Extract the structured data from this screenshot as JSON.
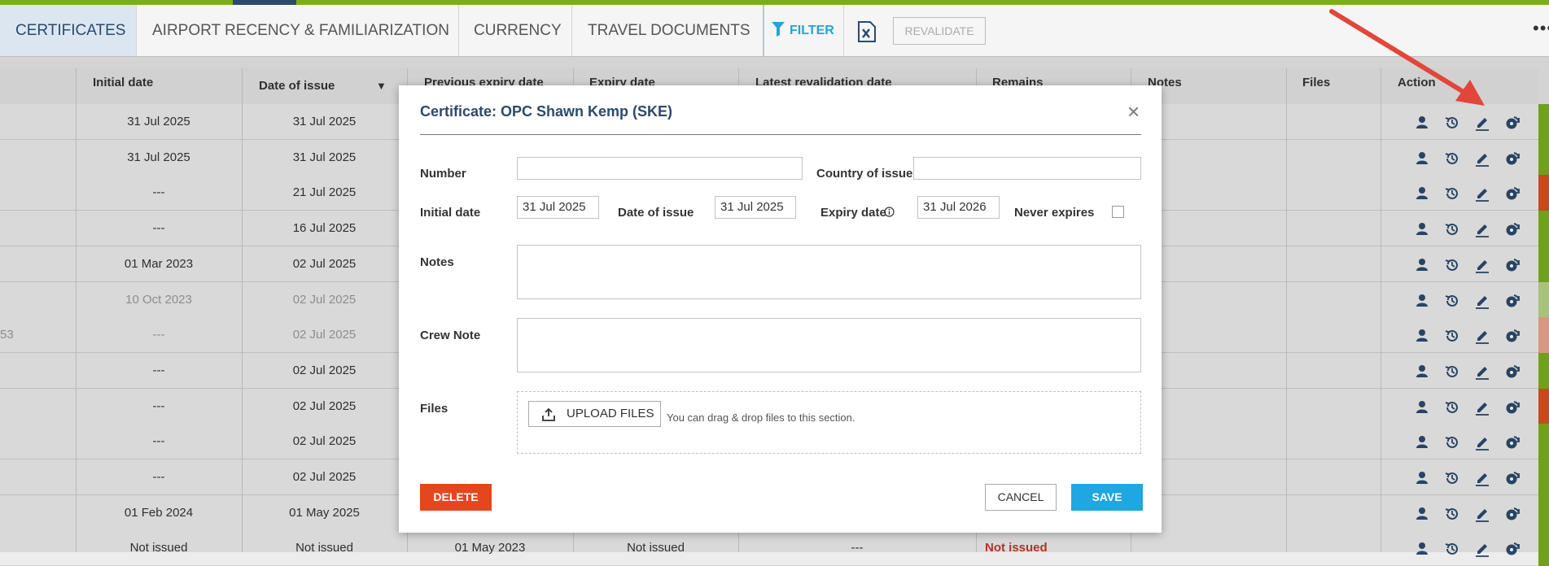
{
  "tabs": [
    {
      "label": "CERTIFICATES"
    },
    {
      "label": "AIRPORT RECENCY & FAMILIARIZATION"
    },
    {
      "label": "CURRENCY"
    },
    {
      "label": "TRAVEL DOCUMENTS"
    }
  ],
  "toolbar": {
    "filter_label": "FILTER",
    "revalidate_label": "REVALIDATE",
    "more_label": "•••"
  },
  "grid": {
    "columns": [
      "Initial date",
      "Date of issue",
      "Previous expiry date",
      "Expiry date",
      "Latest revalidation date",
      "Remains",
      "Notes",
      "Files",
      "Action"
    ],
    "rows": [
      {
        "prefix": "",
        "initial": "31 Jul 2025",
        "issue": "31 Jul 2025",
        "status": "green"
      },
      {
        "prefix": "",
        "initial": "31 Jul 2025",
        "issue": "31 Jul 2025",
        "status": "green"
      },
      {
        "prefix": "",
        "initial": "---",
        "issue": "21 Jul 2025",
        "status": "red"
      },
      {
        "prefix": "",
        "initial": "---",
        "issue": "16 Jul 2025",
        "status": "green"
      },
      {
        "prefix": "",
        "initial": "01 Mar 2023",
        "issue": "02 Jul 2025",
        "status": "green"
      },
      {
        "prefix": "",
        "initial": "10 Oct 2023",
        "issue": "02 Jul 2025",
        "status": "lightgreen"
      },
      {
        "prefix": "53",
        "initial": "---",
        "issue": "02 Jul 2025",
        "status": "lightred"
      },
      {
        "prefix": "",
        "initial": "---",
        "issue": "02 Jul 2025",
        "status": "green"
      },
      {
        "prefix": "",
        "initial": "---",
        "issue": "02 Jul 2025",
        "status": "red"
      },
      {
        "prefix": "",
        "initial": "---",
        "issue": "02 Jul 2025",
        "status": "green"
      },
      {
        "prefix": "",
        "initial": "---",
        "issue": "02 Jul 2025",
        "status": "green"
      },
      {
        "prefix": "",
        "initial": "01 Feb 2024",
        "issue": "01 May 2025",
        "status": "green"
      },
      {
        "prefix": "",
        "initial": "Not issued",
        "issue": "Not issued",
        "prev": "01 May 2023",
        "expiry": "Not issued",
        "reval": "---",
        "remains": "Not issued",
        "status": "green"
      }
    ]
  },
  "modal": {
    "title": "Certificate: OPC Shawn Kemp (SKE)",
    "close": "×",
    "number_label": "Number",
    "number_value": "",
    "country_label": "Country of issue",
    "country_value": "",
    "initial_label": "Initial date",
    "initial_value": "31 Jul 2025",
    "issue_label": "Date of issue",
    "issue_value": "31 Jul 2025",
    "expiry_label": "Expiry date",
    "expiry_value": "31 Jul 2026",
    "never_label": "Never expires",
    "notes_label": "Notes",
    "crew_note_label": "Crew Note",
    "files_label": "Files",
    "upload_label": "UPLOAD FILES",
    "drop_hint": "You can drag & drop files to this section.",
    "delete_label": "DELETE",
    "cancel_label": "CANCEL",
    "save_label": "SAVE"
  },
  "colors": {
    "accent": "#1ea7e0",
    "danger": "#e4471e",
    "status_green": "#6fa11a",
    "status_red": "#c9491f",
    "annotation_arrow": "#e2463a"
  }
}
